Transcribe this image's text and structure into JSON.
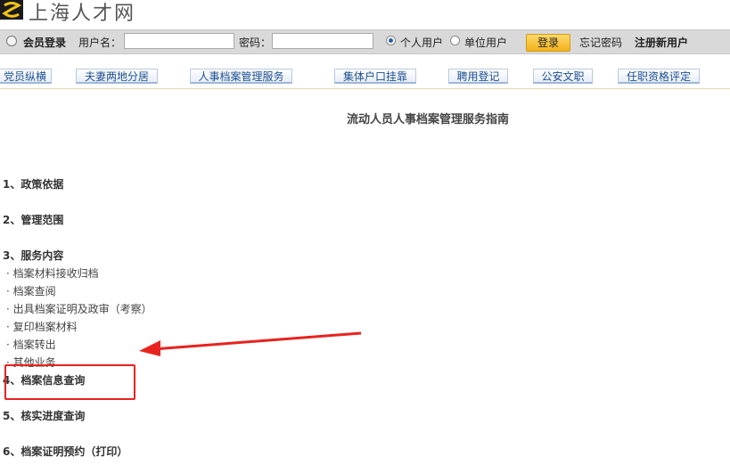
{
  "header": {
    "site_name": "上海人才网"
  },
  "login_bar": {
    "member_login": "会员登录",
    "username_label": "用户名：",
    "username_value": "",
    "password_label": "密码：",
    "password_value": "",
    "radio_personal": "个人用户",
    "radio_company": "单位用户",
    "selected_user_type": "个人用户",
    "login_button": "登录",
    "forgot_password": "忘记密码",
    "register": "注册新用户",
    "button_color": "#f3b21b"
  },
  "nav": {
    "tabs": [
      "党员纵横",
      "夫妻两地分居",
      "人事档案管理服务",
      "集体户口挂靠",
      "聘用登记",
      "公安文职",
      "任职资格评定"
    ],
    "text_color": "#1d4f91"
  },
  "content": {
    "title": "流动人员人事档案管理服务指南",
    "sections": [
      "1、政策依据",
      "2、管理范围",
      "3、服务内容",
      "4、档案信息查询",
      "5、核实进度查询",
      "6、档案证明预约（打印）"
    ],
    "service_items": [
      "· 档案材料接收归档",
      "· 档案查阅",
      "· 出具档案证明及政审（考察）",
      "· 复印档案材料",
      "· 档案转出",
      "· 其他业务"
    ]
  },
  "annotations": {
    "highlight_color": "#e8231f",
    "highlight_icon": "red-arrow-icon"
  }
}
